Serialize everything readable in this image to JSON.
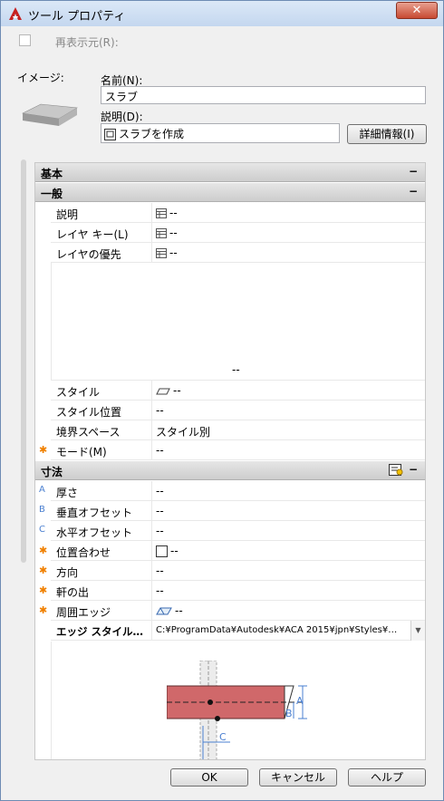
{
  "window": {
    "title": "ツール プロパティ",
    "close": "✕"
  },
  "refresh": {
    "label": "再表示元(R):"
  },
  "image_label": "イメージ:",
  "name": {
    "label": "名前(N):",
    "value": "スラブ"
  },
  "description": {
    "label": "説明(D):",
    "value": "スラブを作成"
  },
  "details_button": "詳細情報(I)",
  "grid": {
    "categories": {
      "basic": "基本",
      "general": "一般",
      "dimensions": "寸法",
      "collapse": "−"
    },
    "general_rows": [
      {
        "name": "説明",
        "value": "--"
      },
      {
        "name": "レイヤ キー(L)",
        "value": "--"
      },
      {
        "name": "レイヤの優先",
        "value": "--"
      }
    ],
    "blank_value": "--",
    "style_rows": [
      {
        "name": "スタイル",
        "value": "--"
      },
      {
        "name": "スタイル位置",
        "value": "--"
      },
      {
        "name": "境界スペース",
        "value": "スタイル別"
      },
      {
        "name": "モード(M)",
        "value": "--",
        "mark": "✱"
      }
    ],
    "dim_rows": [
      {
        "name": "厚さ",
        "value": "--",
        "mark": "A"
      },
      {
        "name": "垂直オフセット",
        "value": "--",
        "mark": "B"
      },
      {
        "name": "水平オフセット",
        "value": "--",
        "mark": "C"
      },
      {
        "name": "位置合わせ",
        "value": "--",
        "mark": "✱"
      },
      {
        "name": "方向",
        "value": "--",
        "mark": "✱"
      },
      {
        "name": "軒の出",
        "value": "--",
        "mark": "✱"
      },
      {
        "name": "周囲エッジ",
        "value": "--",
        "mark": "✱"
      }
    ],
    "edge_style": {
      "name": "エッジ スタイル…",
      "value": "C:¥ProgramData¥Autodesk¥ACA  2015¥jpn¥Styles¥…"
    },
    "preview_labels": {
      "a": "A",
      "b": "B",
      "c": "C"
    }
  },
  "buttons": {
    "ok": "OK",
    "cancel": "キャンセル",
    "help": "ヘルプ"
  },
  "colors": {
    "accent_orange": "#f08000",
    "dim_blue": "#4a7fd0",
    "slab_red": "#d0686a"
  }
}
